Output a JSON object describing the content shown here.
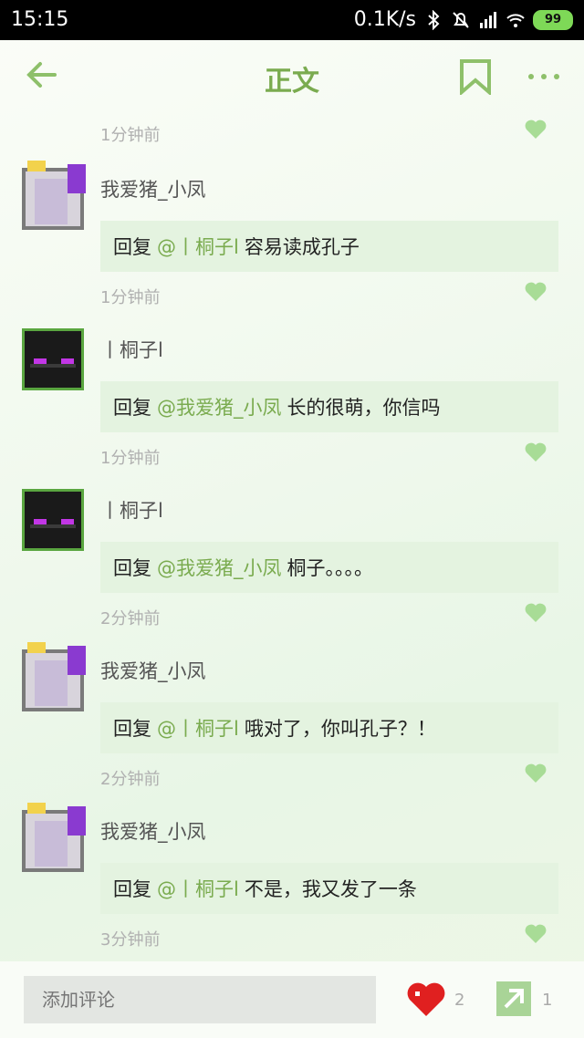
{
  "status_bar": {
    "time": "15:15",
    "speed": "0.1K/s",
    "battery": "99"
  },
  "header": {
    "title": "正文"
  },
  "first_time": "1分钟前",
  "comments": [
    {
      "name": "我爱猪_小凤",
      "reply_prefix": "回复",
      "mention": "@丨桐子l",
      "text": "容易读成孔子",
      "time": "1分钟前"
    },
    {
      "name": "丨桐子l",
      "reply_prefix": "回复",
      "mention": "@我爱猪_小凤",
      "text": "长的很萌，你信吗",
      "time": "1分钟前"
    },
    {
      "name": "丨桐子l",
      "reply_prefix": "回复",
      "mention": "@我爱猪_小凤",
      "text": "桐子。。。。",
      "time": "2分钟前"
    },
    {
      "name": "我爱猪_小凤",
      "reply_prefix": "回复",
      "mention": "@丨桐子l",
      "text": "哦对了，你叫孔子？！",
      "time": "2分钟前"
    },
    {
      "name": "我爱猪_小凤",
      "reply_prefix": "回复",
      "mention": "@丨桐子l",
      "text": "不是，我又发了一条",
      "time": "3分钟前"
    }
  ],
  "bottom_bar": {
    "comment_placeholder": "添加评论",
    "like_count": "2",
    "share_count": "1"
  },
  "colors": {
    "accent": "#7aab4f",
    "bubble": "#e4f3e0",
    "heart": "#e02020"
  }
}
